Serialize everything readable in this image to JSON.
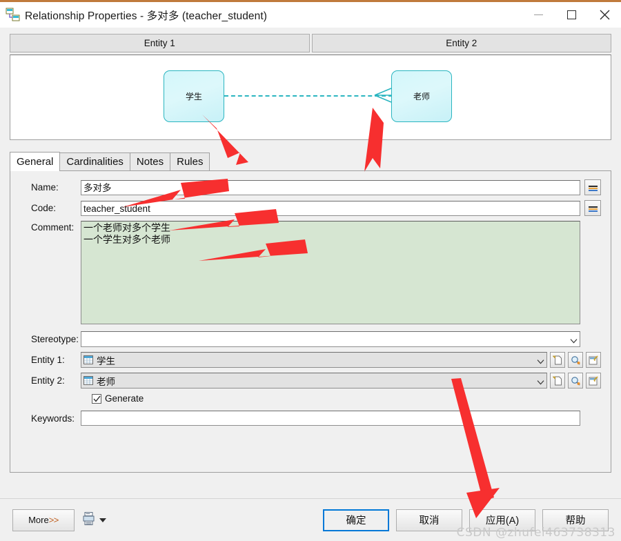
{
  "window": {
    "icon": "relationship-icon",
    "title": "Relationship Properties - 多对多 (teacher_student)",
    "minimize_label": "minimize-icon",
    "maximize_label": "maximize-icon",
    "close_label": "close-icon"
  },
  "preview": {
    "entity1_tab": "Entity 1",
    "entity2_tab": "Entity 2",
    "entity1_name": "学生",
    "entity2_name": "老师",
    "link_style": "dashed",
    "link_color": "#2ab5c0",
    "entity_fill": "#d4f7fb",
    "entity_border": "#2ab5c0"
  },
  "tabs": [
    {
      "label": "General",
      "active": true
    },
    {
      "label": "Cardinalities",
      "active": false
    },
    {
      "label": "Notes",
      "active": false
    },
    {
      "label": "Rules",
      "active": false
    }
  ],
  "form": {
    "name_label": "Name:",
    "name_value": "多对多",
    "code_label": "Code:",
    "code_value": "teacher_student",
    "equals_button_title": "=",
    "comment_label": "Comment:",
    "comment_value": "一个老师对多个学生\n一个学生对多个老师",
    "comment_bg": "#d6e6d2",
    "stereotype_label": "Stereotype:",
    "stereotype_value": "",
    "entity1_label": "Entity 1:",
    "entity1_value": "学生",
    "entity2_label": "Entity 2:",
    "entity2_value": "老师",
    "generate_label": "Generate",
    "generate_checked": true,
    "keywords_label": "Keywords:",
    "keywords_value": "",
    "row_icon_buttons": [
      "create-icon",
      "browse-icon",
      "properties-icon"
    ]
  },
  "footer": {
    "more_label": "More ",
    "more_chevrons": ">>",
    "print_icon": "print-icon",
    "print_caret": "caret-down-icon",
    "ok_label": "确定",
    "cancel_label": "取消",
    "apply_label": "应用(A)",
    "help_label": "帮助",
    "accent": "#0078d7"
  },
  "watermark": "CSDN @zhufei463738313"
}
